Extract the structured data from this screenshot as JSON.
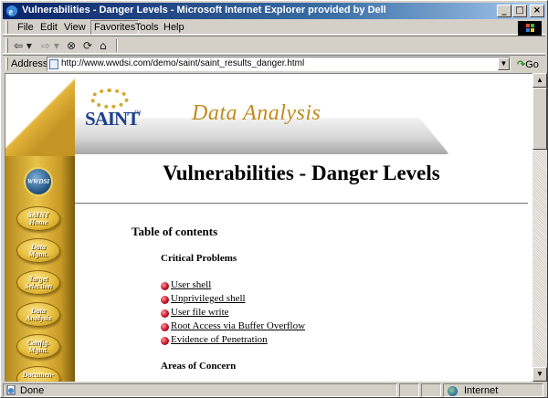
{
  "window": {
    "title": "Vulnerabilities - Danger Levels - Microsoft Internet Explorer provided by Dell",
    "min_label": "_",
    "max_label": "□",
    "close_label": "×"
  },
  "menu": {
    "items": [
      "File",
      "Edit",
      "View",
      "Favorites",
      "Tools",
      "Help"
    ],
    "active": "Favorites"
  },
  "toolbar": {
    "back_label": "⇦ ▾",
    "forward_label": "⇨ ▾",
    "stop_label": "⊗",
    "refresh_label": "⟳",
    "home_label": "⌂"
  },
  "address": {
    "label": "Address",
    "url": "http://www.wwdsi.com/demo/saint/saint_results_danger.html",
    "go_label": "Go",
    "go_arrow": "↷"
  },
  "site": {
    "logo_text": "SAINT",
    "logo_tm": "TM",
    "section_banner": "Data Analysis",
    "wwdsi_label": "WWDSI",
    "nav": [
      "SAINT\nHome",
      "Data\nMgmt.",
      "Target\nSelection",
      "Data\nAnalysis",
      "Config.\nMgmt.",
      "Documen-"
    ]
  },
  "page": {
    "title": "Vulnerabilities - Danger Levels",
    "toc_heading": "Table of contents",
    "critical_heading": "Critical Problems",
    "critical_items": [
      "User shell",
      "Unprivileged shell",
      "User file write",
      "Root Access via Buffer Overflow",
      "Evidence of Penetration"
    ],
    "concern_heading": "Areas of Concern"
  },
  "status": {
    "left_text": "Done",
    "zone_text": "Internet"
  },
  "colors": {
    "titlebar_start": "#0a246a",
    "gold": "#e6bd3c",
    "banner_text": "#c08a1c",
    "saint_blue": "#1d3f8e",
    "bullet_red": "#c4122a"
  }
}
